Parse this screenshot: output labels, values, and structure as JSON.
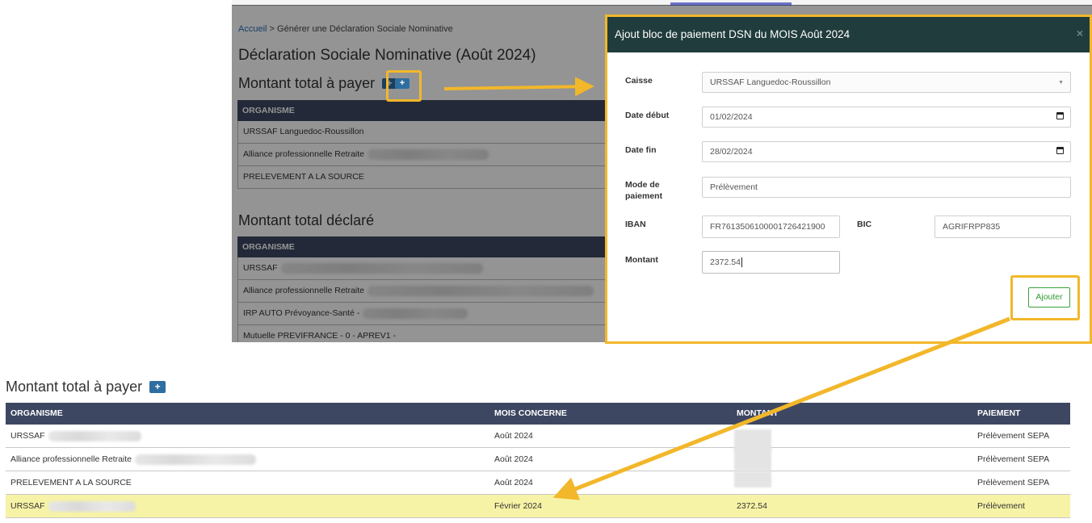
{
  "page": {
    "breadcrumb": {
      "home": "Accueil",
      "separator": ">",
      "current": "Générer une Déclaration Sociale Nominative"
    },
    "title": "Déclaration Sociale Nominative (Août 2024)",
    "section_payer": "Montant total à payer",
    "section_declare": "Montant total déclaré",
    "plus_symbol": "+",
    "table_header": "ORGANISME",
    "payer_rows": [
      "URSSAF Languedoc-Roussillon",
      "Alliance professionnelle Retraite",
      "PRELEVEMENT A LA SOURCE"
    ],
    "declare_rows": [
      "URSSAF",
      "Alliance professionnelle Retraite",
      "IRP AUTO Prévoyance-Santé -",
      "Mutuelle PREVIFRANCE - 0 - APREV1 -"
    ]
  },
  "modal": {
    "title": "Ajout bloc de paiement DSN du MOIS Août 2024",
    "close": "×",
    "labels": {
      "caisse": "Caisse",
      "date_debut": "Date début",
      "date_fin": "Date fin",
      "mode_paiement": "Mode de paiement",
      "iban": "IBAN",
      "bic": "BIC",
      "montant": "Montant"
    },
    "values": {
      "caisse": "URSSAF Languedoc-Roussillon",
      "date_debut": "01/02/2024",
      "date_fin": "28/02/2024",
      "mode_paiement": "Prélèvement",
      "iban": "FR7613506100001726421900",
      "bic": "AGRIFRPP835",
      "montant": "2372.54"
    },
    "submit_label": "Ajouter"
  },
  "bottom": {
    "title": "Montant total à payer",
    "plus_symbol": "+",
    "headers": [
      "ORGANISME",
      "MOIS CONCERNE",
      "MONTANT",
      "PAIEMENT"
    ],
    "rows": [
      {
        "organisme": "URSSAF",
        "mois": "Août 2024",
        "montant": "",
        "paiement": "Prélèvement SEPA"
      },
      {
        "organisme": "Alliance professionnelle Retraite",
        "mois": "Août 2024",
        "montant": "",
        "paiement": "Prélèvement SEPA"
      },
      {
        "organisme": "PRELEVEMENT A LA SOURCE",
        "mois": "Août 2024",
        "montant": "",
        "paiement": "Prélèvement SEPA"
      },
      {
        "organisme": "URSSAF",
        "mois": "Février 2024",
        "montant": "2372.54",
        "paiement": "Prélèvement"
      }
    ]
  },
  "colors": {
    "highlight": "#f2b72a",
    "row_highlight": "#f6f3a6",
    "table_header": "#3d4761",
    "modal_header": "#213c3c"
  }
}
